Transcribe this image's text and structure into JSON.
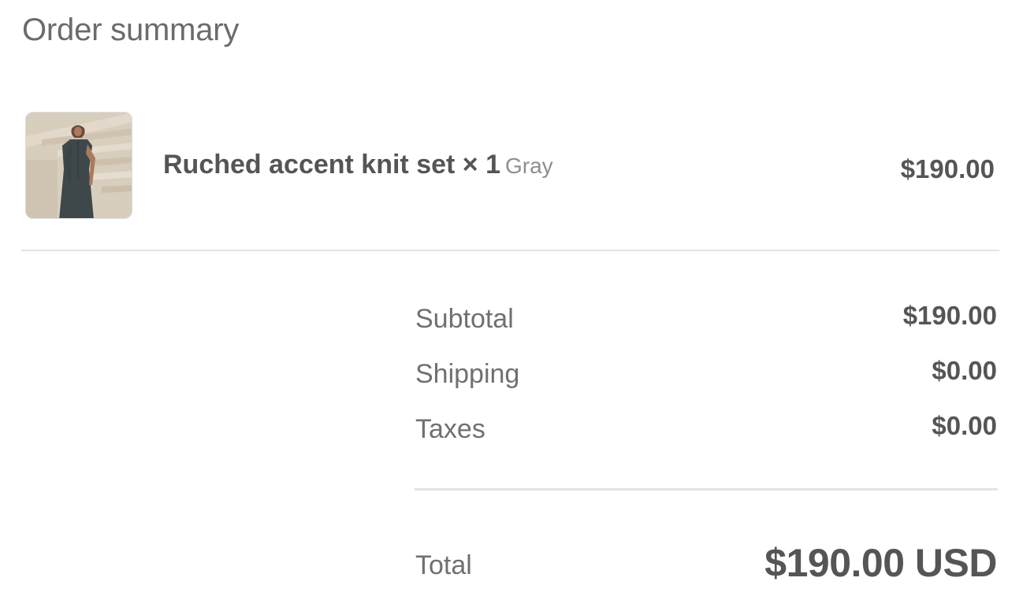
{
  "summary": {
    "title": "Order summary"
  },
  "line_item": {
    "name": "Ruched accent knit set × 1",
    "variant": "Gray",
    "price": "$190.00",
    "image_icon": "product-photo"
  },
  "totals": {
    "subtotal_label": "Subtotal",
    "subtotal_value": "$190.00",
    "shipping_label": "Shipping",
    "shipping_value": "$0.00",
    "taxes_label": "Taxes",
    "taxes_value": "$0.00",
    "total_label": "Total",
    "total_value": "$190.00 USD"
  },
  "colors": {
    "text_primary": "#555555",
    "text_secondary": "#707070",
    "divider": "#e3e3e3"
  }
}
